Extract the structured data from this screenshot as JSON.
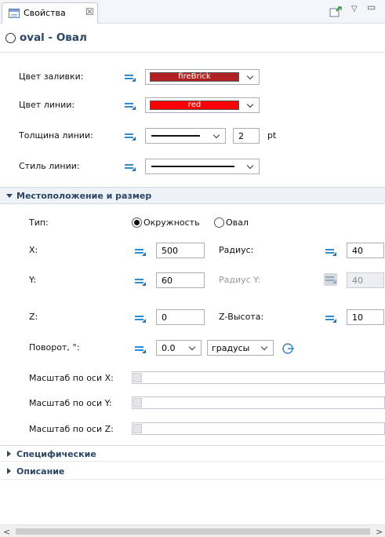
{
  "tab": {
    "label": "Свойства",
    "close_glyph": "☒",
    "icon": "properties-icon"
  },
  "toolbar": {
    "view_menu_glyph": "▽",
    "minimize_glyph": "▭"
  },
  "title": {
    "text": "oval - Овал"
  },
  "appearance": {
    "fill_color_label": "Цвет заливки:",
    "fill_color_value": "fireBrick",
    "fill_color_hex": "#b22222",
    "line_color_label": "Цвет линии:",
    "line_color_value": "red",
    "line_color_hex": "#ff0000",
    "line_width_label": "Толщина линии:",
    "line_width_value": "2",
    "line_width_unit": "pt",
    "line_style_label": "Стиль линии:"
  },
  "location": {
    "section_title": "Местоположение и размер",
    "type_label": "Тип:",
    "type_option_circle": "Окружность",
    "type_option_oval": "Овал",
    "x_label": "X:",
    "x_value": "500",
    "radius_label": "Радиус:",
    "radius_value": "40",
    "y_label": "Y:",
    "y_value": "60",
    "radius_y_label": "Радиус Y:",
    "radius_y_value": "40",
    "z_label": "Z:",
    "z_value": "0",
    "z_height_label": "Z-Высота:",
    "z_height_value": "10",
    "rotation_label": "Поворот, °:",
    "rotation_value": "0.0",
    "rotation_unit": "градусы",
    "scale_x_label": "Масштаб по оси X:",
    "scale_y_label": "Масштаб по оси Y:",
    "scale_z_label": "Масштаб по оси Z:"
  },
  "sections": {
    "specific": "Специфические",
    "description": "Описание"
  },
  "scrollbar": {
    "left_glyph": "<",
    "right_glyph": ">"
  },
  "colors": {
    "accent": "#2f8dcf",
    "header_text": "#2c4563"
  }
}
